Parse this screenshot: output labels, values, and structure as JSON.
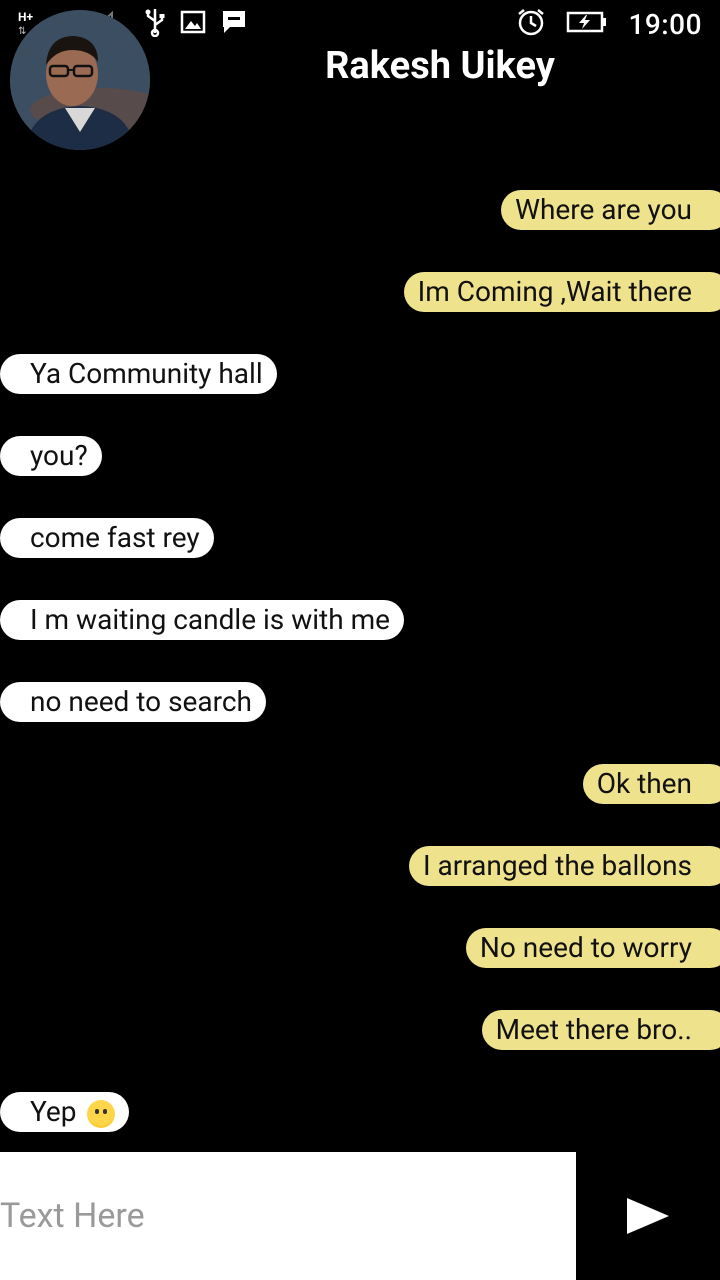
{
  "status_bar": {
    "network_label": "H+",
    "sim_label": "2",
    "time": "19:00"
  },
  "header": {
    "contact_name": "Rakesh Uikey"
  },
  "messages": [
    {
      "side": "sent",
      "text": "Where are you"
    },
    {
      "side": "sent",
      "text": "Im Coming ,Wait there"
    },
    {
      "side": "received",
      "text": "Ya Community hall"
    },
    {
      "side": "received",
      "text": "you?"
    },
    {
      "side": "received",
      "text": "come fast rey"
    },
    {
      "side": "received",
      "text": "I m waiting candle is with me"
    },
    {
      "side": "received",
      "text": "no need to search"
    },
    {
      "side": "sent",
      "text": "Ok then"
    },
    {
      "side": "sent",
      "text": "I arranged the ballons"
    },
    {
      "side": "sent",
      "text": "No need to worry"
    },
    {
      "side": "sent",
      "text": "Meet there bro.."
    },
    {
      "side": "received",
      "text": "Yep",
      "emoji": "hugging-face-emoji"
    }
  ],
  "composer": {
    "placeholder": "Text Here",
    "send_icon": "play-send-icon"
  },
  "colors": {
    "background": "#000000",
    "sent_bubble": "#efe28c",
    "received_bubble": "#ffffff"
  }
}
